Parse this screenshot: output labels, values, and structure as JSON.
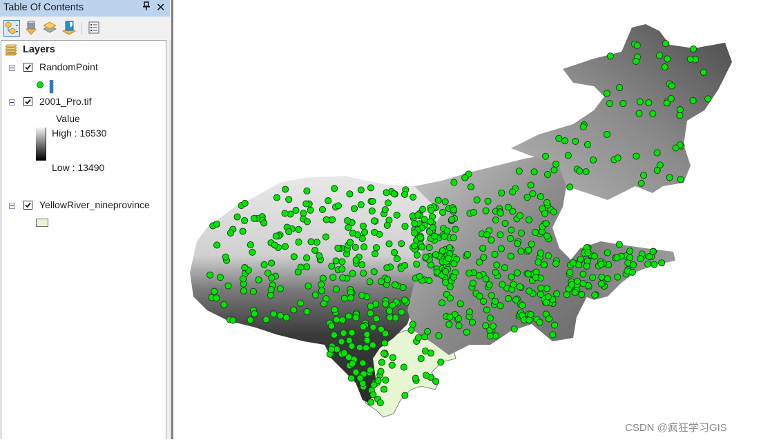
{
  "toc": {
    "title": "Table Of Contents",
    "pin_icon": "pin-icon",
    "close_icon": "close-icon",
    "toolbar": [
      {
        "name": "list-by-drawing-order",
        "icon": "drawing-order-icon",
        "active": true
      },
      {
        "name": "list-by-source",
        "icon": "source-icon",
        "active": false
      },
      {
        "name": "list-by-visibility",
        "icon": "visibility-icon",
        "active": false
      },
      {
        "name": "list-by-selection",
        "icon": "selection-icon",
        "active": false
      },
      {
        "name": "options",
        "icon": "options-icon",
        "active": false
      }
    ],
    "root_label": "Layers",
    "layers": [
      {
        "name": "RandomPoint",
        "checked": true,
        "expanded": true,
        "symbol": {
          "type": "point",
          "color": "#00e600"
        }
      },
      {
        "name": "2001_Pro.tif",
        "checked": true,
        "expanded": true,
        "legend": {
          "field": "Value",
          "high_label": "High : 16530",
          "low_label": "Low : 13490",
          "high_color": "#ffffff",
          "low_color": "#000000"
        }
      },
      {
        "name": "YellowRiver_nineprovince",
        "checked": true,
        "expanded": true,
        "symbol": {
          "type": "polygon",
          "color": "#e6f5d2"
        }
      }
    ]
  },
  "map": {
    "point_color": "#00e600",
    "polygon_fill": "#e6f5d2"
  },
  "watermark": "CSDN @疯狂学习GIS"
}
